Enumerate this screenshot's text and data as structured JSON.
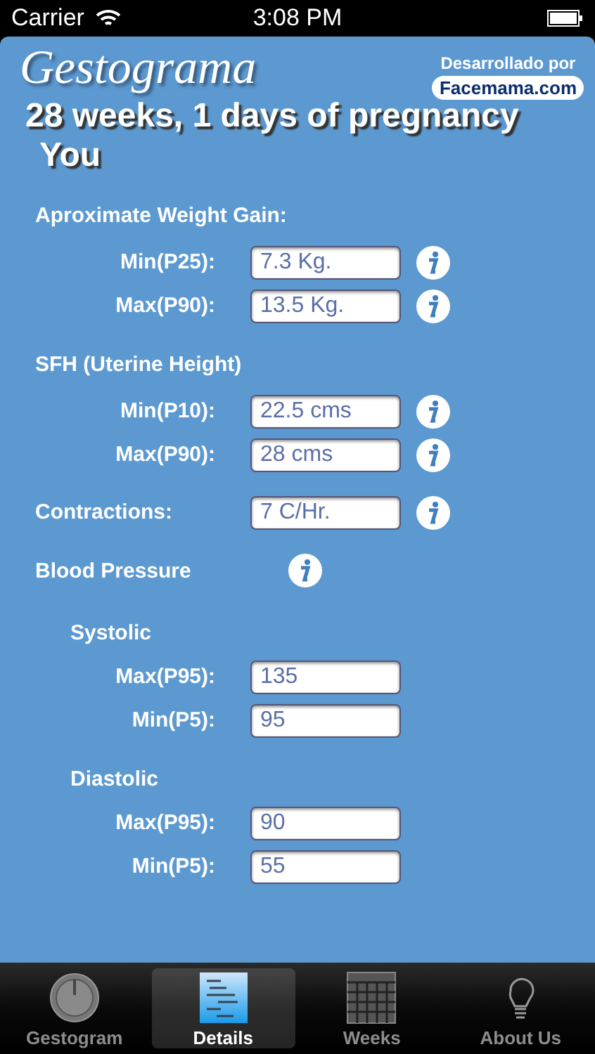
{
  "status_bar": {
    "carrier": "Carrier",
    "time": "3:08 PM"
  },
  "header": {
    "app_title": "Gestograma",
    "credit": "Desarrollado por",
    "brand": "Facemama",
    "brand_suffix": ".com"
  },
  "summary": {
    "headline": "28 weeks, 1 days of pregnancy",
    "subject": "You"
  },
  "items": [
    {
      "kind": "section",
      "label": "Aproximate Weight Gain:",
      "info": false
    },
    {
      "kind": "field",
      "label": "Min(P25):",
      "value": "7.3 Kg.",
      "info": true
    },
    {
      "kind": "field",
      "label": "Max(P90):",
      "value": "13.5 Kg.",
      "info": true
    },
    {
      "kind": "section",
      "label": "SFH (Uterine Height)",
      "info": false
    },
    {
      "kind": "field",
      "label": "Min(P10):",
      "value": "22.5 cms",
      "info": true
    },
    {
      "kind": "field",
      "label": "Max(P90):",
      "value": "28 cms",
      "info": true
    },
    {
      "kind": "inline",
      "label": "Contractions:",
      "value": "7 C/Hr.",
      "info": true
    },
    {
      "kind": "section",
      "label": "Blood Pressure",
      "info": true
    },
    {
      "kind": "subsection",
      "label": "Systolic",
      "info": false
    },
    {
      "kind": "field",
      "label": "Max(P95):",
      "value": "135",
      "info": false
    },
    {
      "kind": "field",
      "label": "Min(P5):",
      "value": "95",
      "info": false
    },
    {
      "kind": "subsection",
      "label": "Diastolic",
      "info": false
    },
    {
      "kind": "field",
      "label": "Max(P95):",
      "value": "90",
      "info": false
    },
    {
      "kind": "field",
      "label": "Min(P5):",
      "value": "55",
      "info": false
    }
  ],
  "tabs": [
    {
      "label": "Gestogram",
      "selected": false
    },
    {
      "label": "Details",
      "selected": true
    },
    {
      "label": "Weeks",
      "selected": false
    },
    {
      "label": "About Us",
      "selected": false
    }
  ]
}
